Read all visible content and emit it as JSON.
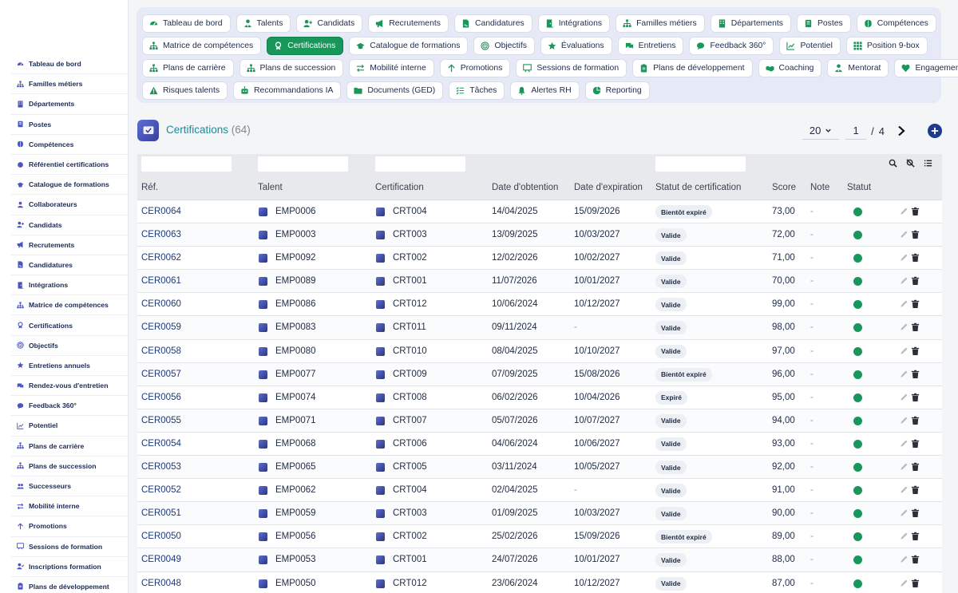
{
  "sidebar": {
    "items": [
      {
        "label": "Tableau de bord",
        "icon": "dashboard-icon"
      },
      {
        "label": "Familles métiers",
        "icon": "hierarchy-icon"
      },
      {
        "label": "Départements",
        "icon": "building-icon"
      },
      {
        "label": "Postes",
        "icon": "badge-icon"
      },
      {
        "label": "Compétences",
        "icon": "brain-icon"
      },
      {
        "label": "Référentiel certifications",
        "icon": "circle-icon"
      },
      {
        "label": "Catalogue de formations",
        "icon": "graduation-cap-icon"
      },
      {
        "label": "Collaborateurs",
        "icon": "user-icon"
      },
      {
        "label": "Candidats",
        "icon": "user-plus-icon"
      },
      {
        "label": "Recrutements",
        "icon": "megaphone-icon"
      },
      {
        "label": "Candidatures",
        "icon": "file-signature-icon"
      },
      {
        "label": "Intégrations",
        "icon": "door-icon"
      },
      {
        "label": "Matrice de compétences",
        "icon": "hierarchy-icon"
      },
      {
        "label": "Certifications",
        "icon": "award-icon"
      },
      {
        "label": "Objectifs",
        "icon": "target-icon"
      },
      {
        "label": "Entretiens annuels",
        "icon": "star-icon"
      },
      {
        "label": "Rendez-vous d'entretien",
        "icon": "chat-icon"
      },
      {
        "label": "Feedback 360°",
        "icon": "comment-icon"
      },
      {
        "label": "Potentiel",
        "icon": "chart-icon"
      },
      {
        "label": "Plans de carrière",
        "icon": "hierarchy-icon"
      },
      {
        "label": "Plans de succession",
        "icon": "hierarchy-icon"
      },
      {
        "label": "Successeurs",
        "icon": "users-icon"
      },
      {
        "label": "Mobilité interne",
        "icon": "arrows-icon"
      },
      {
        "label": "Promotions",
        "icon": "arrow-up-icon"
      },
      {
        "label": "Sessions de formation",
        "icon": "chalkboard-icon"
      },
      {
        "label": "Inscriptions formation",
        "icon": "user-check-icon"
      },
      {
        "label": "Plans de développement",
        "icon": "clipboard-icon"
      }
    ]
  },
  "tabs": {
    "rows": [
      [
        {
          "label": "Tableau de bord",
          "icon": "dashboard-icon"
        },
        {
          "label": "Talents",
          "icon": "user-tie-icon"
        },
        {
          "label": "Candidats",
          "icon": "user-plus-icon"
        },
        {
          "label": "Recrutements",
          "icon": "megaphone-icon"
        },
        {
          "label": "Candidatures",
          "icon": "file-signature-icon"
        },
        {
          "label": "Intégrations",
          "icon": "door-icon"
        },
        {
          "label": "Familles métiers",
          "icon": "hierarchy-icon"
        },
        {
          "label": "Départements",
          "icon": "building-icon"
        },
        {
          "label": "Postes",
          "icon": "badge-icon"
        },
        {
          "label": "Compétences",
          "icon": "brain-icon"
        }
      ],
      [
        {
          "label": "Matrice de compétences",
          "icon": "hierarchy-icon"
        },
        {
          "label": "Certifications",
          "icon": "award-icon",
          "active": true
        },
        {
          "label": "Catalogue de formations",
          "icon": "graduation-cap-icon"
        },
        {
          "label": "Objectifs",
          "icon": "target-icon"
        },
        {
          "label": "Évaluations",
          "icon": "star-icon"
        },
        {
          "label": "Entretiens",
          "icon": "chat-icon"
        },
        {
          "label": "Feedback 360°",
          "icon": "comment-icon"
        },
        {
          "label": "Potentiel",
          "icon": "chart-icon"
        },
        {
          "label": "Position 9-box",
          "icon": "grid-icon"
        }
      ],
      [
        {
          "label": "Plans de carrière",
          "icon": "hierarchy-icon"
        },
        {
          "label": "Plans de succession",
          "icon": "hierarchy-icon"
        },
        {
          "label": "Mobilité interne",
          "icon": "arrows-icon"
        },
        {
          "label": "Promotions",
          "icon": "arrow-up-icon"
        },
        {
          "label": "Sessions de formation",
          "icon": "chalkboard-icon"
        },
        {
          "label": "Plans de développement",
          "icon": "clipboard-icon"
        },
        {
          "label": "Coaching",
          "icon": "handshake-icon"
        },
        {
          "label": "Mentorat",
          "icon": "user-tie-icon"
        },
        {
          "label": "Engagement",
          "icon": "heart-icon"
        }
      ],
      [
        {
          "label": "Risques talents",
          "icon": "warning-icon"
        },
        {
          "label": "Recommandations IA",
          "icon": "robot-icon"
        },
        {
          "label": "Documents (GED)",
          "icon": "folder-icon"
        },
        {
          "label": "Tâches",
          "icon": "tasks-icon"
        },
        {
          "label": "Alertes RH",
          "icon": "bell-icon"
        },
        {
          "label": "Reporting",
          "icon": "pie-icon"
        }
      ]
    ]
  },
  "header": {
    "title": "Certifications",
    "count": "(64)",
    "per_page": "20",
    "page": "1",
    "page_sep": "/",
    "total_pages": "4"
  },
  "table": {
    "columns": {
      "ref": "Réf.",
      "talent": "Talent",
      "certification": "Certification",
      "date_obtention": "Date d'obtention",
      "date_expiration": "Date d'expiration",
      "statut_certification": "Statut de certification",
      "score": "Score",
      "note": "Note",
      "statut": "Statut"
    },
    "rows": [
      {
        "ref": "CER0064",
        "talent": "EMP0006",
        "cert": "CRT004",
        "obtained": "14/04/2025",
        "expires": "15/09/2026",
        "status": "Bientôt expiré",
        "score": "73,00",
        "note": "-"
      },
      {
        "ref": "CER0063",
        "talent": "EMP0003",
        "cert": "CRT003",
        "obtained": "13/09/2025",
        "expires": "10/03/2027",
        "status": "Valide",
        "score": "72,00",
        "note": "-"
      },
      {
        "ref": "CER0062",
        "talent": "EMP0092",
        "cert": "CRT002",
        "obtained": "12/02/2026",
        "expires": "10/02/2027",
        "status": "Valide",
        "score": "71,00",
        "note": "-"
      },
      {
        "ref": "CER0061",
        "talent": "EMP0089",
        "cert": "CRT001",
        "obtained": "11/07/2026",
        "expires": "10/01/2027",
        "status": "Valide",
        "score": "70,00",
        "note": "-"
      },
      {
        "ref": "CER0060",
        "talent": "EMP0086",
        "cert": "CRT012",
        "obtained": "10/06/2024",
        "expires": "10/12/2027",
        "status": "Valide",
        "score": "99,00",
        "note": "-"
      },
      {
        "ref": "CER0059",
        "talent": "EMP0083",
        "cert": "CRT011",
        "obtained": "09/11/2024",
        "expires": "-",
        "status": "Valide",
        "score": "98,00",
        "note": "-"
      },
      {
        "ref": "CER0058",
        "talent": "EMP0080",
        "cert": "CRT010",
        "obtained": "08/04/2025",
        "expires": "10/10/2027",
        "status": "Valide",
        "score": "97,00",
        "note": "-"
      },
      {
        "ref": "CER0057",
        "talent": "EMP0077",
        "cert": "CRT009",
        "obtained": "07/09/2025",
        "expires": "15/08/2026",
        "status": "Bientôt expiré",
        "score": "96,00",
        "note": "-"
      },
      {
        "ref": "CER0056",
        "talent": "EMP0074",
        "cert": "CRT008",
        "obtained": "06/02/2026",
        "expires": "10/04/2026",
        "status": "Expiré",
        "score": "95,00",
        "note": "-"
      },
      {
        "ref": "CER0055",
        "talent": "EMP0071",
        "cert": "CRT007",
        "obtained": "05/07/2026",
        "expires": "10/07/2027",
        "status": "Valide",
        "score": "94,00",
        "note": "-"
      },
      {
        "ref": "CER0054",
        "talent": "EMP0068",
        "cert": "CRT006",
        "obtained": "04/06/2024",
        "expires": "10/06/2027",
        "status": "Valide",
        "score": "93,00",
        "note": "-"
      },
      {
        "ref": "CER0053",
        "talent": "EMP0065",
        "cert": "CRT005",
        "obtained": "03/11/2024",
        "expires": "10/05/2027",
        "status": "Valide",
        "score": "92,00",
        "note": "-"
      },
      {
        "ref": "CER0052",
        "talent": "EMP0062",
        "cert": "CRT004",
        "obtained": "02/04/2025",
        "expires": "-",
        "status": "Valide",
        "score": "91,00",
        "note": "-"
      },
      {
        "ref": "CER0051",
        "talent": "EMP0059",
        "cert": "CRT003",
        "obtained": "01/09/2025",
        "expires": "10/03/2027",
        "status": "Valide",
        "score": "90,00",
        "note": "-"
      },
      {
        "ref": "CER0050",
        "talent": "EMP0056",
        "cert": "CRT002",
        "obtained": "25/02/2026",
        "expires": "15/09/2026",
        "status": "Bientôt expiré",
        "score": "89,00",
        "note": "-"
      },
      {
        "ref": "CER0049",
        "talent": "EMP0053",
        "cert": "CRT001",
        "obtained": "24/07/2026",
        "expires": "10/01/2027",
        "status": "Valide",
        "score": "88,00",
        "note": "-"
      },
      {
        "ref": "CER0048",
        "talent": "EMP0050",
        "cert": "CRT012",
        "obtained": "23/06/2024",
        "expires": "10/12/2027",
        "status": "Valide",
        "score": "87,00",
        "note": "-"
      }
    ]
  },
  "colors": {
    "accent_green": "#17975a",
    "title_teal": "#1f8a9a",
    "nav_text": "#1b2a55",
    "status_active": "#18975a"
  }
}
